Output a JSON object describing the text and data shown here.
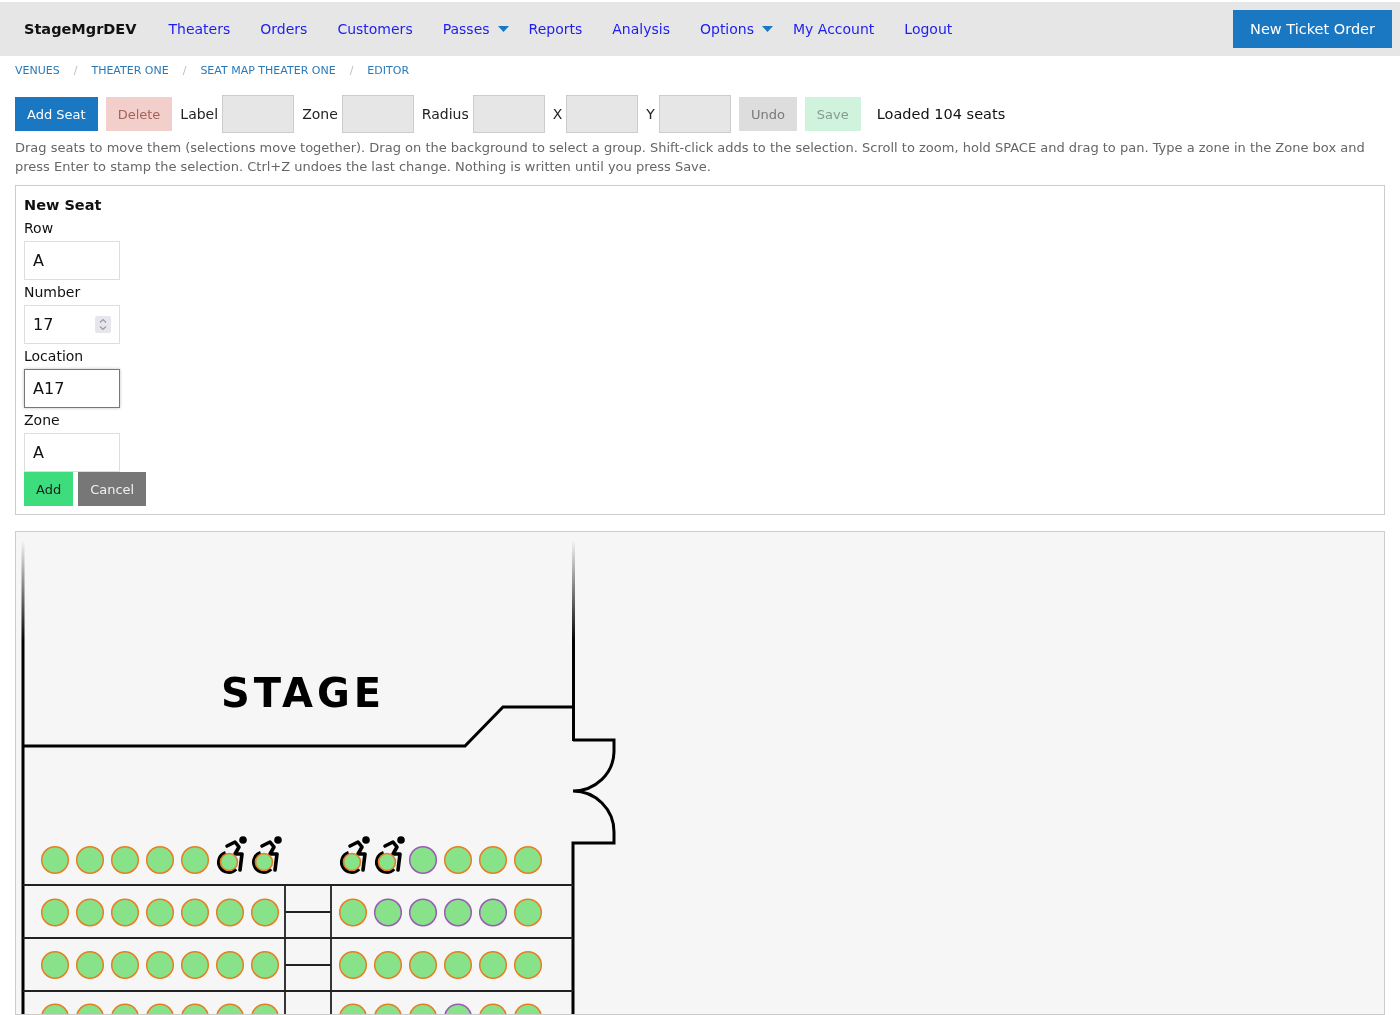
{
  "navbar": {
    "brand": "StageMgrDEV",
    "links": [
      {
        "label": "Theaters",
        "kind": "link"
      },
      {
        "label": "Orders",
        "kind": "link"
      },
      {
        "label": "Customers",
        "kind": "link"
      },
      {
        "label": "Passes",
        "kind": "dropdown"
      },
      {
        "label": "Reports",
        "kind": "link"
      },
      {
        "label": "Analysis",
        "kind": "link"
      },
      {
        "label": "Options",
        "kind": "dropdown"
      },
      {
        "label": "My Account",
        "kind": "link"
      },
      {
        "label": "Logout",
        "kind": "link"
      }
    ],
    "action_button": "New Ticket Order"
  },
  "breadcrumb": [
    {
      "kind": "link",
      "label": "VENUES"
    },
    {
      "kind": "separator",
      "label": "/"
    },
    {
      "kind": "link",
      "label": "THEATER ONE"
    },
    {
      "kind": "separator",
      "label": "/"
    },
    {
      "kind": "link",
      "label": "SEAT MAP THEATER ONE"
    },
    {
      "kind": "separator",
      "label": "/"
    },
    {
      "kind": "link",
      "label": "EDITOR"
    }
  ],
  "toolbar": [
    {
      "kind": "primary",
      "label": "Add Seat",
      "disabled": false
    },
    {
      "kind": "danger",
      "label": "Delete",
      "disabled": true
    },
    {
      "kind": "field",
      "label": "Label",
      "disabled": true
    },
    {
      "kind": "field",
      "label": "Zone",
      "disabled": true
    },
    {
      "kind": "field",
      "label": "Radius",
      "disabled": true
    },
    {
      "kind": "field",
      "label": "X",
      "disabled": true
    },
    {
      "kind": "field",
      "label": "Y",
      "disabled": true
    },
    {
      "kind": "secondary",
      "label": "Undo",
      "disabled": true
    },
    {
      "kind": "success",
      "label": "Save",
      "disabled": true
    },
    {
      "kind": "status",
      "label": "Loaded 104 seats"
    }
  ],
  "hint": "Drag seats to move them (selections move together). Drag on the background to select a group. Shift-click adds to the selection. Scroll to zoom, hold SPACE and drag to pan. Type a zone in the Zone box and press Enter to stamp the selection. Ctrl+Z undoes the last change. Nothing is written until you press Save.",
  "new_seat": {
    "title": "New Seat",
    "fields": [
      {
        "label": "Row",
        "value": "A",
        "kind": "text",
        "focused": false
      },
      {
        "label": "Number",
        "value": "17",
        "kind": "number",
        "focused": false
      },
      {
        "label": "Location",
        "value": "A17",
        "kind": "text",
        "focused": true
      },
      {
        "label": "Zone",
        "value": "A",
        "kind": "text",
        "focused": false
      }
    ],
    "buttons": [
      {
        "label": "Add",
        "kind": "success"
      },
      {
        "label": "Cancel",
        "kind": "secondary"
      }
    ]
  },
  "seat_map": {
    "stage_label": "STAGE",
    "rows": [
      {
        "sections": [
          {
            "seats": [
              {
                "color": "#e67e22",
                "accessible": false
              },
              {
                "color": "#e67e22",
                "accessible": false
              },
              {
                "color": "#e67e22",
                "accessible": false
              },
              {
                "color": "#e67e22",
                "accessible": false
              },
              {
                "color": "#e67e22",
                "accessible": false
              },
              {
                "color": "#e67e22",
                "accessible": true
              },
              {
                "color": "#e67e22",
                "accessible": true
              }
            ]
          },
          {
            "seats": [
              {
                "color": "#e67e22",
                "accessible": true
              },
              {
                "color": "#e67e22",
                "accessible": true
              },
              {
                "color": "#9b59b6",
                "accessible": false
              },
              {
                "color": "#e67e22",
                "accessible": false
              },
              {
                "color": "#e67e22",
                "accessible": false
              },
              {
                "color": "#e67e22",
                "accessible": false
              }
            ]
          }
        ]
      },
      {
        "sections": [
          {
            "seats": [
              {
                "color": "#e67e22",
                "accessible": false
              },
              {
                "color": "#e67e22",
                "accessible": false
              },
              {
                "color": "#e67e22",
                "accessible": false
              },
              {
                "color": "#e67e22",
                "accessible": false
              },
              {
                "color": "#e67e22",
                "accessible": false
              },
              {
                "color": "#e67e22",
                "accessible": false
              },
              {
                "color": "#e67e22",
                "accessible": false
              }
            ]
          },
          {
            "seats": [
              {
                "color": "#e67e22",
                "accessible": false
              },
              {
                "color": "#9b59b6",
                "accessible": false
              },
              {
                "color": "#9b59b6",
                "accessible": false
              },
              {
                "color": "#9b59b6",
                "accessible": false
              },
              {
                "color": "#9b59b6",
                "accessible": false
              },
              {
                "color": "#e67e22",
                "accessible": false
              }
            ]
          }
        ]
      },
      {
        "sections": [
          {
            "seats": [
              {
                "color": "#e67e22",
                "accessible": false
              },
              {
                "color": "#e67e22",
                "accessible": false
              },
              {
                "color": "#e67e22",
                "accessible": false
              },
              {
                "color": "#e67e22",
                "accessible": false
              },
              {
                "color": "#e67e22",
                "accessible": false
              },
              {
                "color": "#e67e22",
                "accessible": false
              },
              {
                "color": "#e67e22",
                "accessible": false
              }
            ]
          },
          {
            "seats": [
              {
                "color": "#e67e22",
                "accessible": false
              },
              {
                "color": "#e67e22",
                "accessible": false
              },
              {
                "color": "#e67e22",
                "accessible": false
              },
              {
                "color": "#e67e22",
                "accessible": false
              },
              {
                "color": "#e67e22",
                "accessible": false
              },
              {
                "color": "#e67e22",
                "accessible": false
              }
            ]
          }
        ]
      },
      {
        "sections": [
          {
            "seats": [
              {
                "color": "#e67e22",
                "accessible": false
              },
              {
                "color": "#e67e22",
                "accessible": false
              },
              {
                "color": "#e67e22",
                "accessible": false
              },
              {
                "color": "#e67e22",
                "accessible": false
              },
              {
                "color": "#e67e22",
                "accessible": false
              },
              {
                "color": "#e67e22",
                "accessible": false
              },
              {
                "color": "#e67e22",
                "accessible": false
              }
            ]
          },
          {
            "seats": [
              {
                "color": "#e67e22",
                "accessible": false
              },
              {
                "color": "#e67e22",
                "accessible": false
              },
              {
                "color": "#e67e22",
                "accessible": false
              },
              {
                "color": "#9b59b6",
                "accessible": false
              },
              {
                "color": "#e67e22",
                "accessible": false
              },
              {
                "color": "#e67e22",
                "accessible": false
              }
            ]
          }
        ]
      }
    ]
  }
}
